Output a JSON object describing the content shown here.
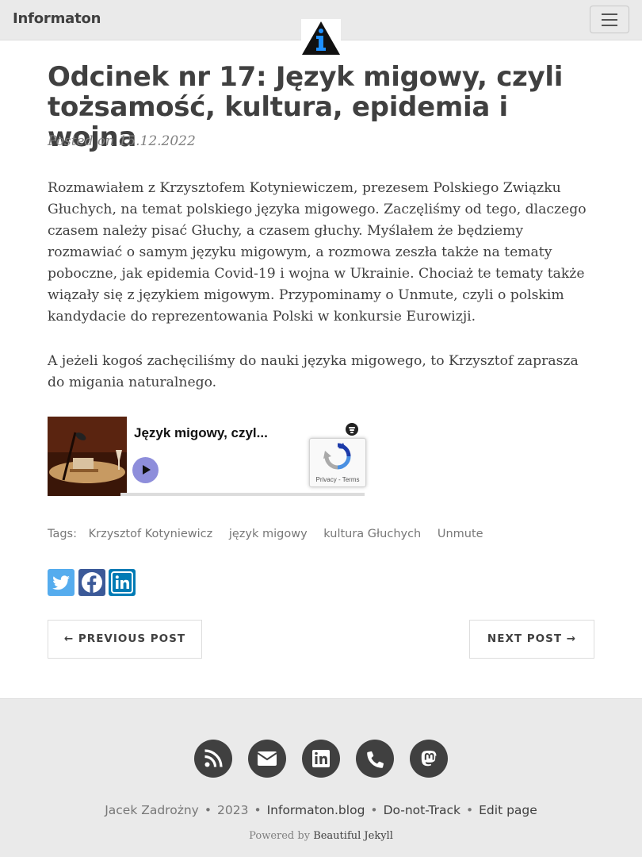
{
  "navbar": {
    "brand": "Informaton",
    "logo_icon": "info-triangle-logo",
    "menu_icon": "hamburger-icon"
  },
  "post": {
    "title": "Odcinek nr 17: Język migowy, czyli tożsamość, kultura, epidemia i wojna",
    "meta": "Posted on 15.12.2022",
    "paragraphs": [
      "Rozmawiałem z Krzysztofem Kotyniewiczem, prezesem Polskiego Związku Głuchych, na temat polskiego języka migowego. Zaczęliśmy od tego, dlaczego czasem należy pisać Głuchy, a czasem głuchy. Myślałem że będziemy rozmawiać o samym języku migowym, a rozmowa zeszła także na tematy poboczne, jak epidemia Covid-19 i wojna w Ukrainie. Chociaż te tematy także wiązały się z językiem migowym. Przypominamy o Unmute, czyli o polskim kandydacie do reprezentowania Polski w konkursie Eurowizji.",
      "A jeżeli kogoś zachęciliśmy do nauki języka migowego, to Krzysztof zaprasza do migania naturalnego."
    ]
  },
  "embed": {
    "title": "Język migowy, czyl...",
    "recaptcha_links": "Privacy - Terms"
  },
  "tags": {
    "label": "Tags:",
    "items": [
      "Krzysztof Kotyniewicz",
      "język migowy",
      "kultura Głuchych",
      "Unmute"
    ]
  },
  "share": {
    "items": [
      {
        "name": "twitter",
        "color": "#55acee"
      },
      {
        "name": "facebook",
        "color": "#3b5998"
      },
      {
        "name": "linkedin",
        "color": "#007bb5"
      }
    ]
  },
  "pager": {
    "previous": "← PREVIOUS POST",
    "next": "NEXT POST →"
  },
  "footer": {
    "icons": [
      "rss-icon",
      "envelope-icon",
      "linkedin-icon",
      "phone-icon",
      "mastodon-icon"
    ],
    "author": "Jacek Zadrożny",
    "year": "2023",
    "site": "Informaton.blog",
    "dnt": "Do-not-Track",
    "edit": "Edit page",
    "powered_prefix": "Powered by",
    "powered_theme": "Beautiful Jekyll"
  },
  "colors": {
    "navbar_bg": "#eaeaea",
    "text": "#404040",
    "muted": "#808080",
    "footer_icon_bg": "#404040",
    "logo_blue": "#1e90ff"
  }
}
